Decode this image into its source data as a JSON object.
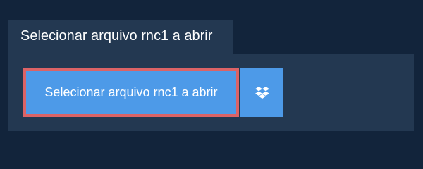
{
  "tab": {
    "label": "Selecionar arquivo rnc1 a abrir"
  },
  "upload": {
    "select_button_label": "Selecionar arquivo rnc1 a abrir",
    "dropbox_icon": "dropbox-icon"
  },
  "colors": {
    "page_background": "#12243b",
    "panel_background": "#233851",
    "button_background": "#4d9ae8",
    "focus_border": "#dc6366",
    "text": "#ffffff"
  }
}
